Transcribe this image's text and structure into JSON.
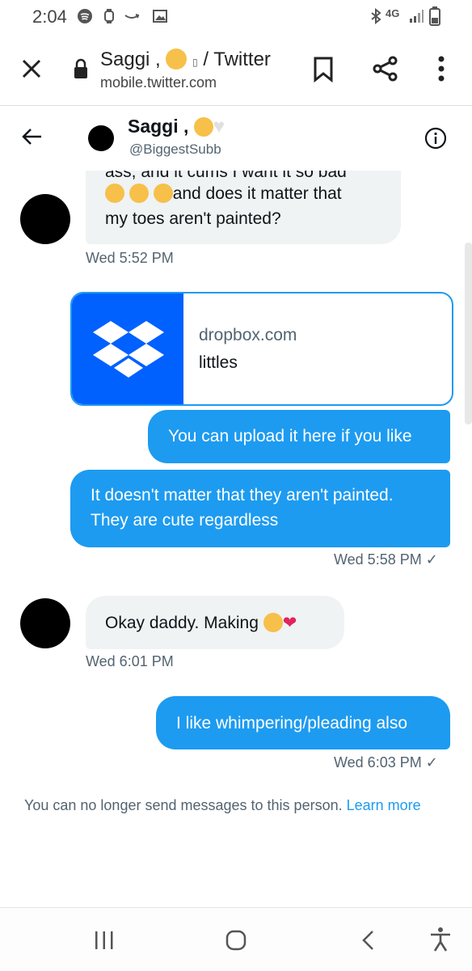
{
  "status_bar": {
    "time": "2:04",
    "network": "4G"
  },
  "browser": {
    "page_title_prefix": "Saggi ,",
    "page_title_suffix": "/ Twitter",
    "url": "mobile.twitter.com"
  },
  "conversation": {
    "name": "Saggi ,",
    "handle": "@BiggestSubb"
  },
  "messages": {
    "m1_cut": "ass, and it cums I want it so bad",
    "m1_line1_text": "and does it matter that",
    "m1_line2": "my toes aren't painted?",
    "m1_time": "Wed 5:52 PM",
    "card_domain": "dropbox.com",
    "card_title": "littles",
    "m2": "You can upload it here if you like",
    "m3_line1": "It doesn't matter that they aren't painted.",
    "m3_line2": "They are cute regardless",
    "m3_time": "Wed 5:58 PM",
    "m4": "Okay daddy. Making",
    "m4_time": "Wed 6:01 PM",
    "m5": "I like whimpering/pleading  also",
    "m5_time": "Wed 6:03 PM"
  },
  "notice": {
    "text": "You can no longer send messages to this person.",
    "link": "Learn more"
  },
  "colors": {
    "twitter_blue": "#1d9bf0",
    "bubble_grey": "#eff3f4",
    "dropbox_blue": "#0061fe"
  }
}
